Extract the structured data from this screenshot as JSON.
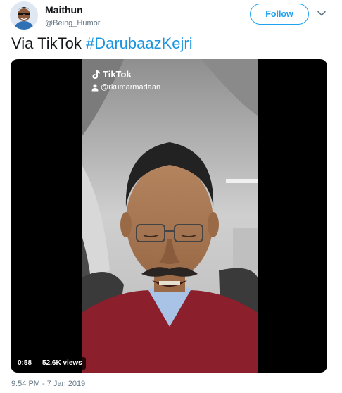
{
  "author": {
    "name": "Maithun",
    "handle": "@Being_Humor",
    "avatar_icon": "cartoon-avatar-with-glasses"
  },
  "actions": {
    "follow_label": "Follow",
    "more_icon": "chevron-down-icon"
  },
  "tweet": {
    "text_prefix": "Via TikTok ",
    "hashtag": "#DarubaazKejri"
  },
  "media": {
    "watermark_brand": "TikTok",
    "watermark_user": "@rkumarmadaan",
    "duration": "0:58",
    "views": "52.6K views"
  },
  "timestamp": "9:54 PM - 7 Jan 2019",
  "colors": {
    "accent": "#1da1f2",
    "hashtag": "#1b95e0",
    "secondary_text": "#657786"
  }
}
